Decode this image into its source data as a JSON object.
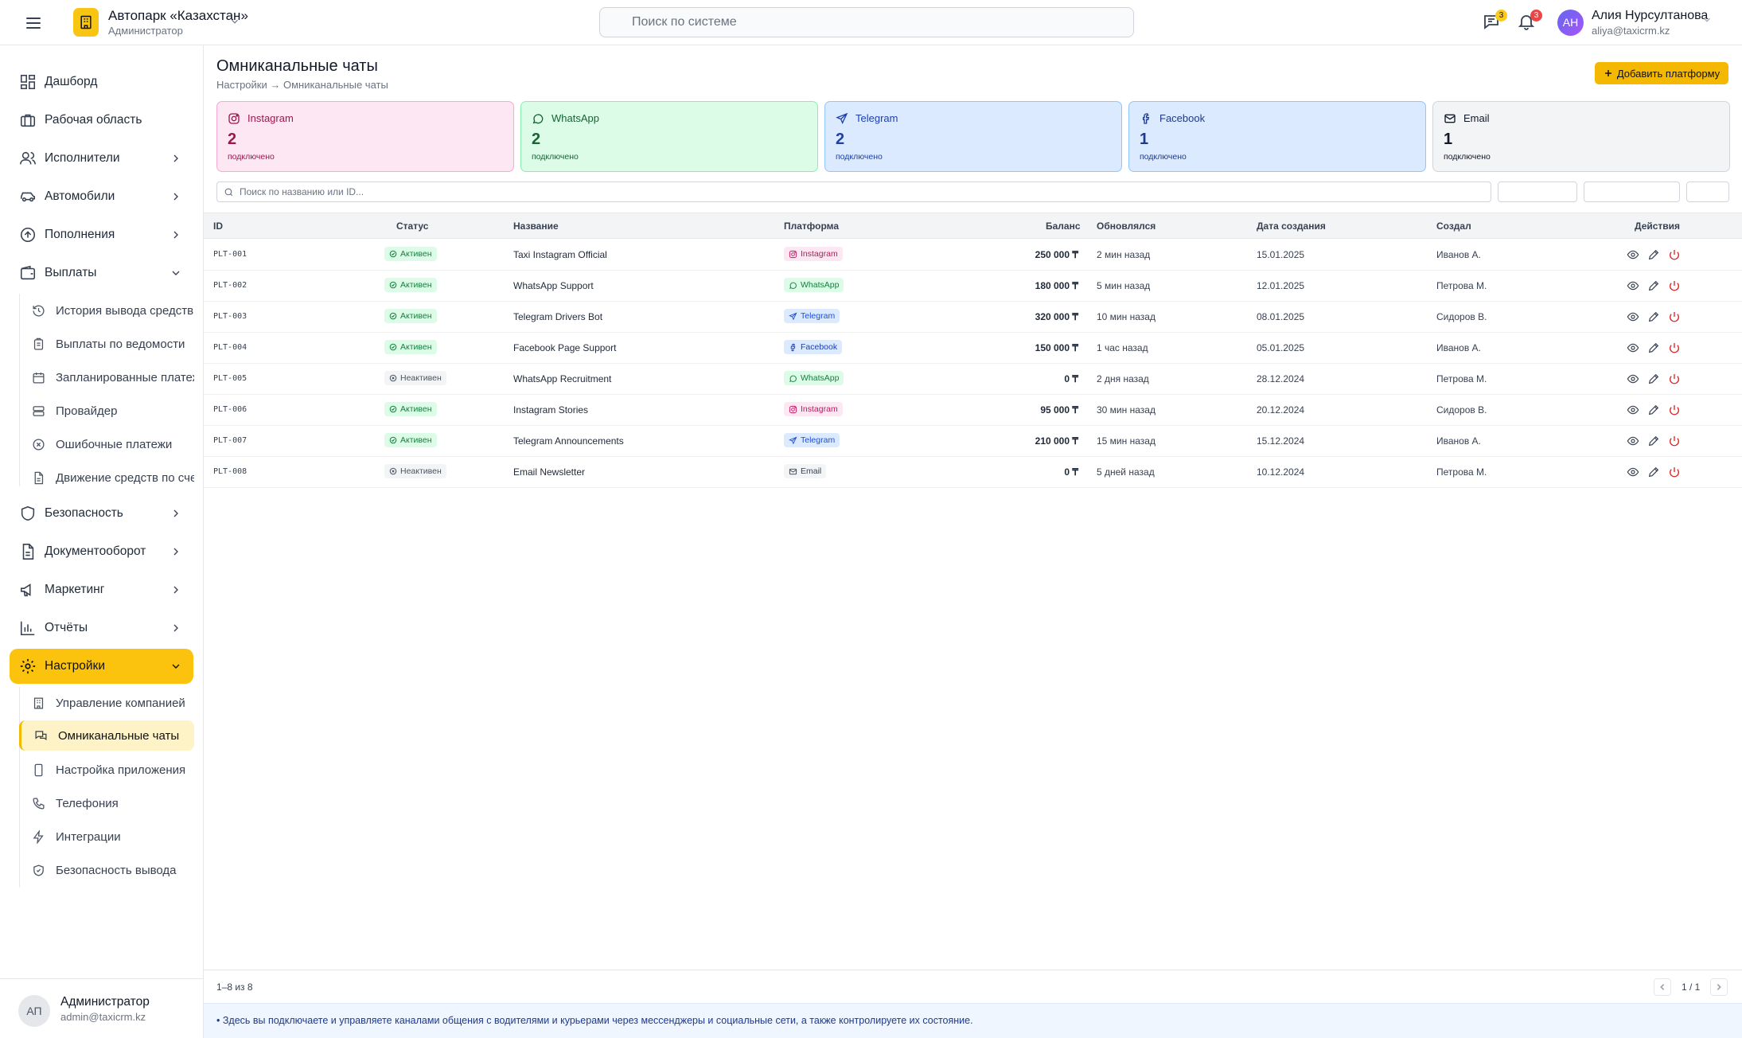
{
  "topbar": {
    "company_name": "Автопарк «Казахстан»",
    "company_role": "Администратор",
    "search_placeholder": "Поиск по системе",
    "messages_badge": "3",
    "notifications_badge": "3",
    "user_initials": "АН",
    "user_name": "Алия Нурсултанова",
    "user_email": "aliya@taxicrm.kz"
  },
  "sidebar": {
    "items": [
      {
        "label": "Дашборд"
      },
      {
        "label": "Рабочая область"
      },
      {
        "label": "Исполнители"
      },
      {
        "label": "Автомобили"
      },
      {
        "label": "Пополнения"
      },
      {
        "label": "Выплаты"
      },
      {
        "label": "Безопасность"
      },
      {
        "label": "Документооборот"
      },
      {
        "label": "Маркетинг"
      },
      {
        "label": "Отчёты"
      },
      {
        "label": "Настройки"
      }
    ],
    "payouts_sub": [
      {
        "label": "История вывода средств"
      },
      {
        "label": "Выплаты по ведомости"
      },
      {
        "label": "Запланированные платежи"
      },
      {
        "label": "Провайдер"
      },
      {
        "label": "Ошибочные платежи"
      },
      {
        "label": "Движение средств по счетам"
      }
    ],
    "settings_sub": [
      {
        "label": "Управление компанией"
      },
      {
        "label": "Омниканальные чаты"
      },
      {
        "label": "Настройка приложения"
      },
      {
        "label": "Телефония"
      },
      {
        "label": "Интеграции"
      },
      {
        "label": "Безопасность вывода"
      }
    ],
    "footer": {
      "initials": "АП",
      "name": "Администратор",
      "email": "admin@taxicrm.kz"
    }
  },
  "page": {
    "title": "Омниканальные чаты",
    "breadcrumb": "Настройки → Омниканальные чаты",
    "add_button": "Добавить платформу",
    "table_search_placeholder": "Поиск по названию или ID..."
  },
  "cards": [
    {
      "name": "Instagram",
      "count": "2",
      "sub": "подключено",
      "bg": "#fce7f3",
      "border": "#f9a8d4",
      "color": "#9d174d",
      "icon": "instagram-icon"
    },
    {
      "name": "WhatsApp",
      "count": "2",
      "sub": "подключено",
      "bg": "#dcfce7",
      "border": "#86efac",
      "color": "#166534",
      "icon": "whatsapp-icon"
    },
    {
      "name": "Telegram",
      "count": "2",
      "sub": "подключено",
      "bg": "#dbeafe",
      "border": "#93c5fd",
      "color": "#1e40af",
      "icon": "telegram-icon"
    },
    {
      "name": "Facebook",
      "count": "1",
      "sub": "подключено",
      "bg": "#dbeafe",
      "border": "#93c5fd",
      "color": "#1e3a8a",
      "icon": "facebook-icon"
    },
    {
      "name": "Email",
      "count": "1",
      "sub": "подключено",
      "bg": "#f3f4f6",
      "border": "#d1d5db",
      "color": "#111827",
      "icon": "email-icon"
    }
  ],
  "table": {
    "headers": {
      "id": "ID",
      "status": "Статус",
      "name": "Название",
      "platform": "Платформа",
      "balance": "Баланс",
      "updated": "Обновлялся",
      "created": "Дата создания",
      "author": "Создал",
      "actions": "Действия"
    },
    "rows": [
      {
        "id": "PLT-001",
        "status": "Активен",
        "active": true,
        "name": "Taxi Instagram Official",
        "platform": "Instagram",
        "balance": "250 000 ₸",
        "updated": "2 мин назад",
        "created": "15.01.2025",
        "author": "Иванов А."
      },
      {
        "id": "PLT-002",
        "status": "Активен",
        "active": true,
        "name": "WhatsApp Support",
        "platform": "WhatsApp",
        "balance": "180 000 ₸",
        "updated": "5 мин назад",
        "created": "12.01.2025",
        "author": "Петрова М."
      },
      {
        "id": "PLT-003",
        "status": "Активен",
        "active": true,
        "name": "Telegram Drivers Bot",
        "platform": "Telegram",
        "balance": "320 000 ₸",
        "updated": "10 мин назад",
        "created": "08.01.2025",
        "author": "Сидоров В."
      },
      {
        "id": "PLT-004",
        "status": "Активен",
        "active": true,
        "name": "Facebook Page Support",
        "platform": "Facebook",
        "balance": "150 000 ₸",
        "updated": "1 час назад",
        "created": "05.01.2025",
        "author": "Иванов А."
      },
      {
        "id": "PLT-005",
        "status": "Неактивен",
        "active": false,
        "name": "WhatsApp Recruitment",
        "platform": "WhatsApp",
        "balance": "0 ₸",
        "updated": "2 дня назад",
        "created": "28.12.2024",
        "author": "Петрова М."
      },
      {
        "id": "PLT-006",
        "status": "Активен",
        "active": true,
        "name": "Instagram Stories",
        "platform": "Instagram",
        "balance": "95 000 ₸",
        "updated": "30 мин назад",
        "created": "20.12.2024",
        "author": "Сидоров В."
      },
      {
        "id": "PLT-007",
        "status": "Активен",
        "active": true,
        "name": "Telegram Announcements",
        "platform": "Telegram",
        "balance": "210 000 ₸",
        "updated": "15 мин назад",
        "created": "15.12.2024",
        "author": "Иванов А."
      },
      {
        "id": "PLT-008",
        "status": "Неактивен",
        "active": false,
        "name": "Email Newsletter",
        "platform": "Email",
        "balance": "0 ₸",
        "updated": "5 дней назад",
        "created": "10.12.2024",
        "author": "Петрова М."
      }
    ],
    "count_text": "1–8 из 8",
    "page_text": "1 / 1"
  },
  "info_text": "Здесь вы подключаете и управляете каналами общения с водителями и курьерами через мессенджеры и социальные сети, а также контролируете их состояние.",
  "colors": {
    "accent": "#f5b800",
    "active_bg": "#fbc30e"
  }
}
